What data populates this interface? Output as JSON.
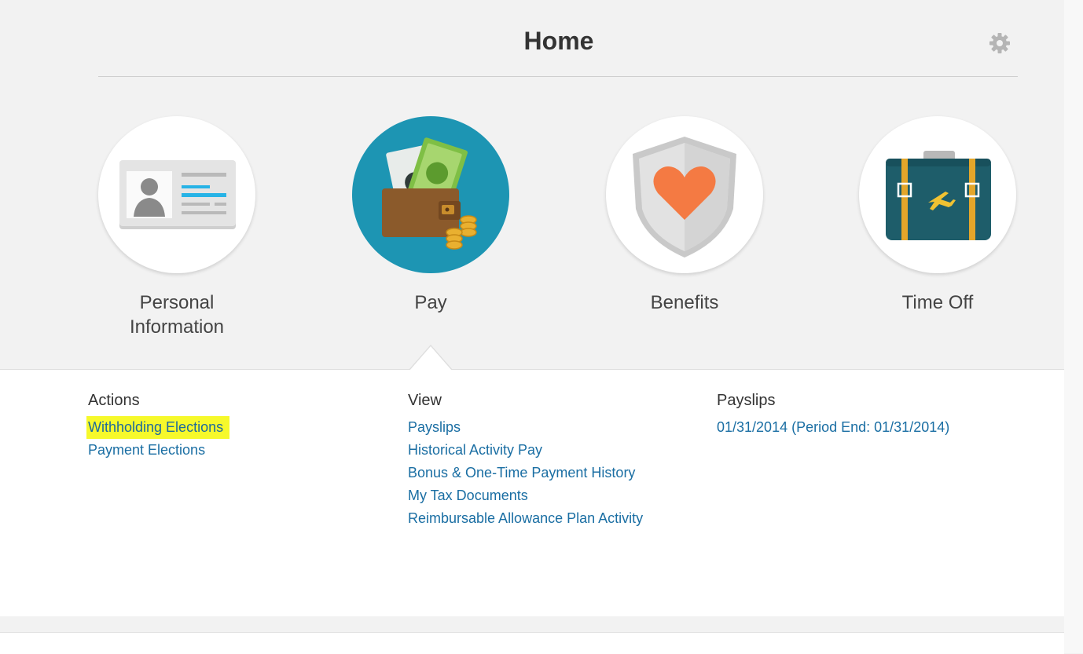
{
  "header": {
    "title": "Home",
    "settings_icon": "gear-icon"
  },
  "worklets": [
    {
      "id": "personal",
      "label": "Personal Information",
      "icon": "id-card-icon",
      "active": false
    },
    {
      "id": "pay",
      "label": "Pay",
      "icon": "wallet-icon",
      "active": true
    },
    {
      "id": "benefits",
      "label": "Benefits",
      "icon": "shield-heart-icon",
      "active": false
    },
    {
      "id": "timeoff",
      "label": "Time Off",
      "icon": "suitcase-icon",
      "active": false
    }
  ],
  "panel": {
    "actions": {
      "heading": "Actions",
      "links": [
        "Withholding Elections",
        "Payment Elections"
      ],
      "highlighted": "Withholding Elections"
    },
    "view": {
      "heading": "View",
      "links": [
        "Payslips",
        "Historical Activity Pay",
        "Bonus & One-Time Payment History",
        "My Tax Documents",
        "Reimbursable Allowance Plan Activity"
      ]
    },
    "payslips": {
      "heading": "Payslips",
      "links": [
        "01/31/2014 (Period End: 01/31/2014)"
      ]
    }
  },
  "colors": {
    "link": "#1a6ea3",
    "active_tile": "#1d95b3",
    "highlight": "#f6f92b",
    "page_bg": "#f2f2f2"
  }
}
